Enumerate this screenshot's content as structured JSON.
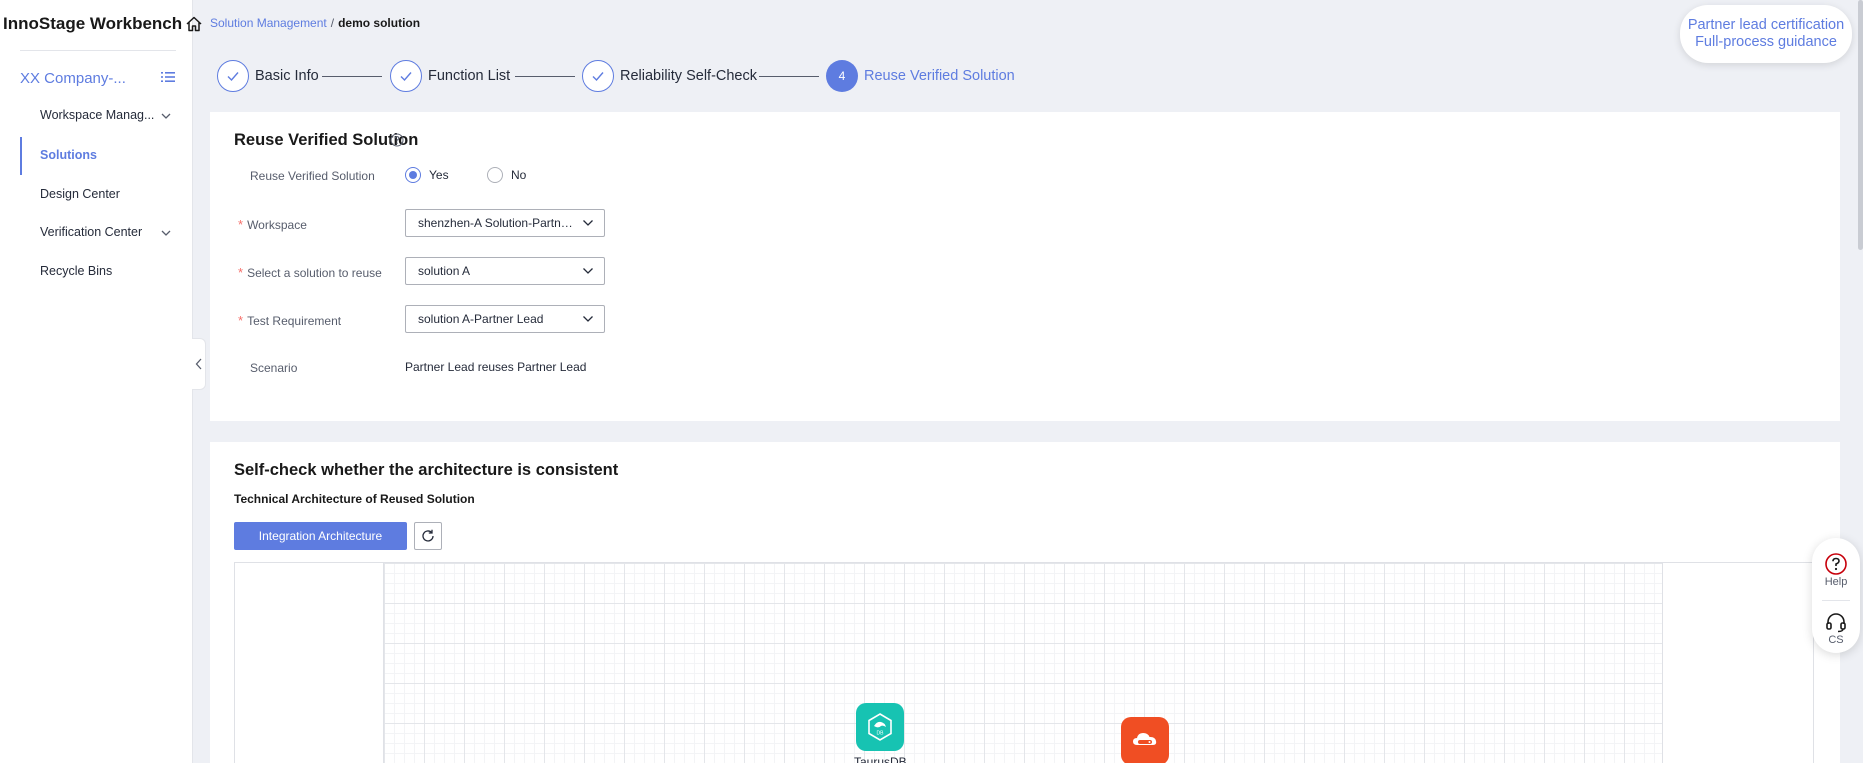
{
  "app": {
    "title": "InnoStage Workbench"
  },
  "sidebar": {
    "company": "XX Company-...",
    "items": [
      {
        "label": "Workspace Manag...",
        "expandable": true
      },
      {
        "label": "Solutions",
        "active": true
      },
      {
        "label": "Design Center"
      },
      {
        "label": "Verification Center",
        "expandable": true
      },
      {
        "label": "Recycle Bins"
      }
    ]
  },
  "breadcrumb": {
    "parent": "Solution Management",
    "separator": "/",
    "current": "demo solution"
  },
  "steps": [
    {
      "label": "Basic Info",
      "state": "done"
    },
    {
      "label": "Function List",
      "state": "done"
    },
    {
      "label": "Reliability Self-Check",
      "state": "done"
    },
    {
      "number": "4",
      "label": "Reuse Verified Solution",
      "state": "current"
    }
  ],
  "guide": {
    "line1": "Partner lead certification",
    "line2": "Full-process guidance"
  },
  "reuse": {
    "title": "Reuse Verified Solution",
    "reuse_label": "Reuse Verified Solution",
    "yes": "Yes",
    "no": "No",
    "selected": "Yes",
    "workspace_label": "Workspace",
    "workspace_value": "shenzhen-A Solution-Partner Lead",
    "solution_label": "Select a solution to reuse",
    "solution_value": "solution A",
    "test_label": "Test Requirement",
    "test_value": "solution A-Partner Lead",
    "scenario_label": "Scenario",
    "scenario_value": "Partner Lead reuses Partner Lead"
  },
  "arch": {
    "title": "Self-check whether the architecture is consistent",
    "subtitle": "Technical Architecture of Reused Solution",
    "button": "Integration Architecture",
    "nodes": [
      {
        "label": "TaurusDB",
        "icon": "taurusdb-icon",
        "color": "#17c3b2"
      },
      {
        "label": "",
        "icon": "cloud-service-icon",
        "color": "#f04e23"
      }
    ]
  },
  "float_panel": {
    "help": "Help",
    "cs": "CS"
  },
  "colors": {
    "accent": "#5e7ce0",
    "required": "#f66f6a"
  }
}
